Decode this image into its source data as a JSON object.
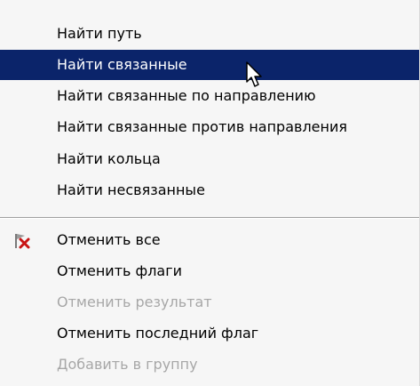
{
  "menu": {
    "items": [
      {
        "label": "Найти путь",
        "state": "normal"
      },
      {
        "label": "Найти связанные",
        "state": "highlighted"
      },
      {
        "label": "Найти связанные по направлению",
        "state": "normal"
      },
      {
        "label": "Найти связанные против направления",
        "state": "normal"
      },
      {
        "label": "Найти кольца",
        "state": "normal"
      },
      {
        "label": "Найти несвязанные",
        "state": "normal"
      },
      {
        "label": "Отменить все",
        "state": "normal",
        "icon": "clear-flags-icon"
      },
      {
        "label": "Отменить флаги",
        "state": "normal"
      },
      {
        "label": "Отменить результат",
        "state": "disabled"
      },
      {
        "label": "Отменить последний флаг",
        "state": "normal"
      },
      {
        "label": "Добавить в группу",
        "state": "disabled"
      }
    ]
  },
  "colors": {
    "menu_background": "#f6f6f6",
    "highlight_background": "#0b246a",
    "highlight_text": "#ffffff",
    "disabled_text": "#a7a7a7",
    "separator": "#a0a0a0"
  },
  "cursor": {
    "icon": "arrow-cursor-icon"
  }
}
